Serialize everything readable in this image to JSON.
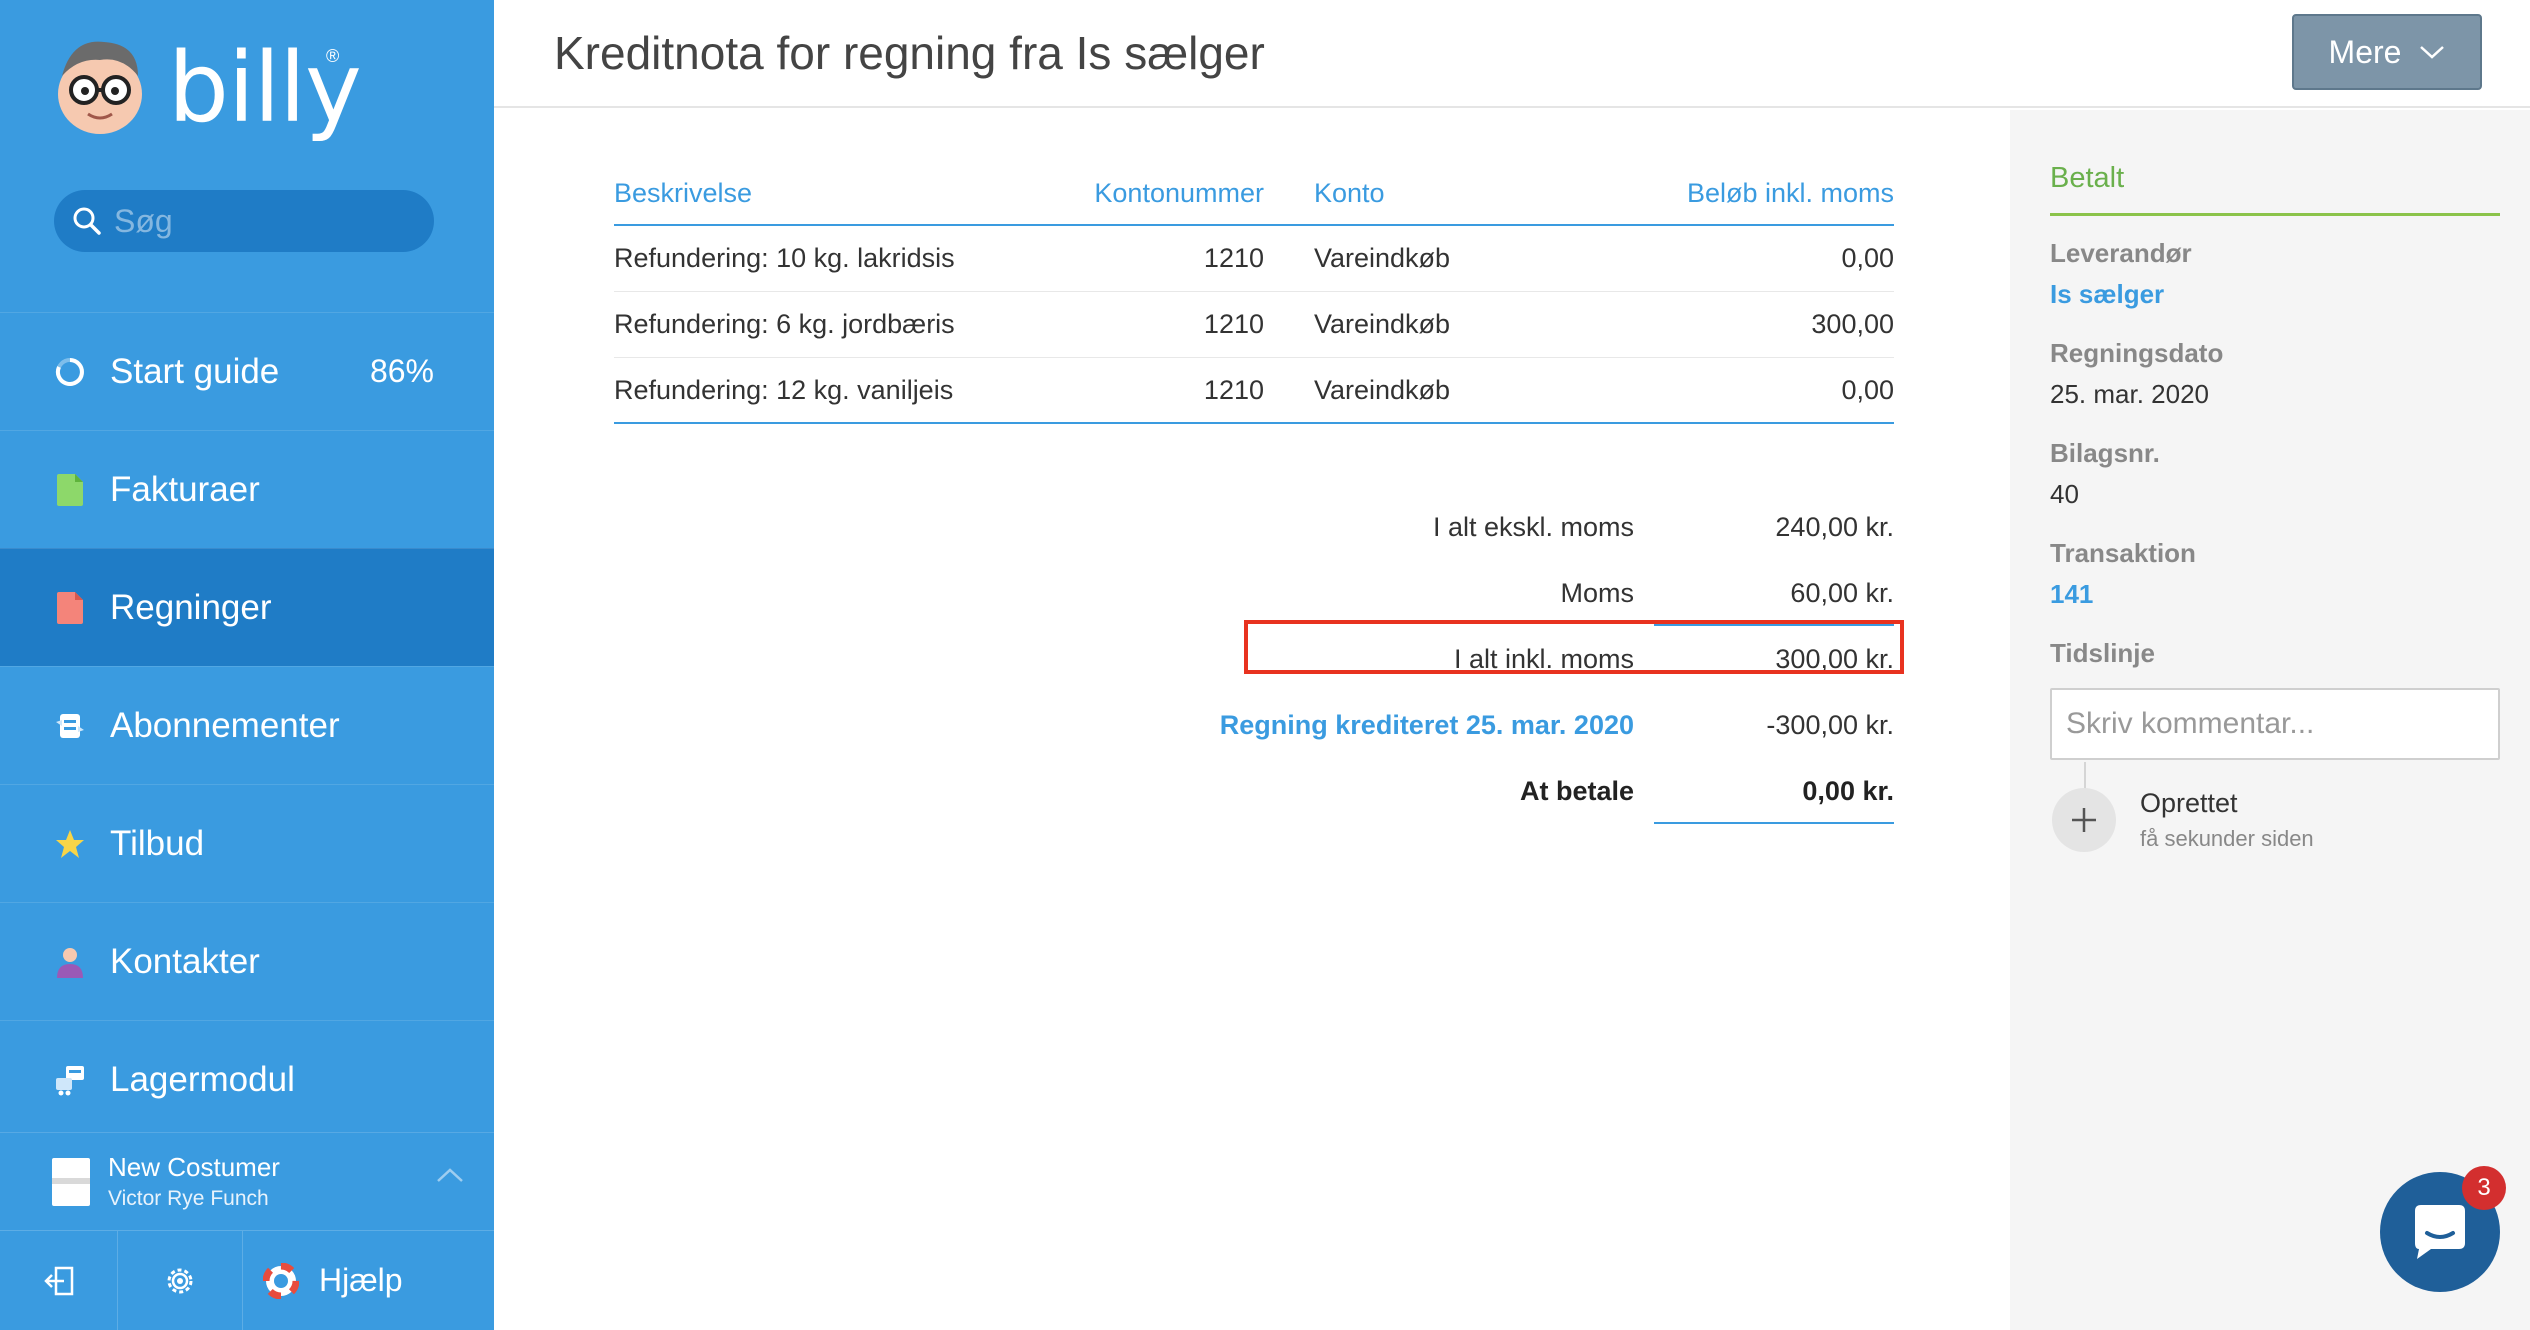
{
  "brand": {
    "name": "billy",
    "registered": "®"
  },
  "search": {
    "placeholder": "Søg"
  },
  "sidebar": {
    "items": [
      {
        "label": "Start guide",
        "icon": "progress-ring-icon",
        "badge": "86%"
      },
      {
        "label": "Fakturaer",
        "icon": "invoice-doc-icon"
      },
      {
        "label": "Regninger",
        "icon": "bill-doc-icon"
      },
      {
        "label": "Abonnementer",
        "icon": "subscription-icon"
      },
      {
        "label": "Tilbud",
        "icon": "star-icon"
      },
      {
        "label": "Kontakter",
        "icon": "person-icon"
      },
      {
        "label": "Lagermodul",
        "icon": "inventory-icon"
      }
    ],
    "active_index": 2,
    "account": {
      "company": "New Costumer",
      "user": "Victor Rye Funch"
    },
    "help_label": "Hjælp"
  },
  "header": {
    "title": "Kreditnota for regning fra Is sælger",
    "more_button": "Mere"
  },
  "table": {
    "columns": [
      "Beskrivelse",
      "Kontonummer",
      "Konto",
      "Beløb inkl. moms"
    ],
    "rows": [
      {
        "desc": "Refundering: 10 kg. lakridsis",
        "account_no": "1210",
        "account": "Vareindkøb",
        "amount": "0,00"
      },
      {
        "desc": "Refundering: 6 kg. jordbæris",
        "account_no": "1210",
        "account": "Vareindkøb",
        "amount": "300,00"
      },
      {
        "desc": "Refundering: 12 kg. vaniljeis",
        "account_no": "1210",
        "account": "Vareindkøb",
        "amount": "0,00"
      }
    ]
  },
  "totals": {
    "excl_label": "I alt ekskl. moms",
    "excl_value": "240,00 kr.",
    "vat_label": "Moms",
    "vat_value": "60,00 kr.",
    "incl_label": "I alt inkl. moms",
    "incl_value": "300,00 kr.",
    "credit_label": "Regning krediteret 25. mar. 2020",
    "credit_value": "-300,00 kr.",
    "due_label": "At betale",
    "due_value": "0,00 kr."
  },
  "details": {
    "status": "Betalt",
    "vendor_label": "Leverandør",
    "vendor": "Is sælger",
    "date_label": "Regningsdato",
    "date": "25. mar. 2020",
    "voucher_label": "Bilagsnr.",
    "voucher": "40",
    "transaction_label": "Transaktion",
    "transaction": "141",
    "timeline_label": "Tidslinje",
    "comment_placeholder": "Skriv kommentar...",
    "timeline_event": "Oprettet",
    "timeline_time": "få sekunder siden"
  },
  "chat": {
    "unread": "3"
  },
  "colors": {
    "sidebar": "#3a9be0",
    "active": "#1f7cc6",
    "accent": "#3a9be0",
    "highlight": "#e8321f",
    "paid": "#6ab04c"
  }
}
